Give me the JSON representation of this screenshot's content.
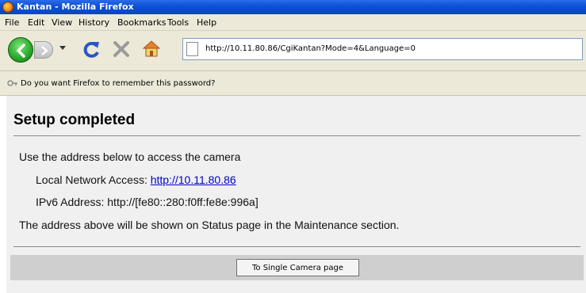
{
  "window": {
    "title": "Kantan - Mozilla Firefox"
  },
  "menu": {
    "items": [
      "File",
      "Edit",
      "View",
      "History",
      "Bookmarks",
      "Tools",
      "Help"
    ]
  },
  "toolbar": {
    "url": "http://10.11.80.86/CgiKantan?Mode=4&Language=0"
  },
  "notification": {
    "text": "Do you want Firefox to remember this password?"
  },
  "page": {
    "heading": "Setup completed",
    "intro": "Use the address below to access the camera",
    "local_label": "Local Network Access: ",
    "local_link": "http://10.11.80.86",
    "ipv6_text": "IPv6 Address: http://[fe80::280:f0ff:fe8e:996a]",
    "status_note": "The address above will be shown on Status page in the Maintenance section.",
    "button_label": "To Single Camera page"
  }
}
